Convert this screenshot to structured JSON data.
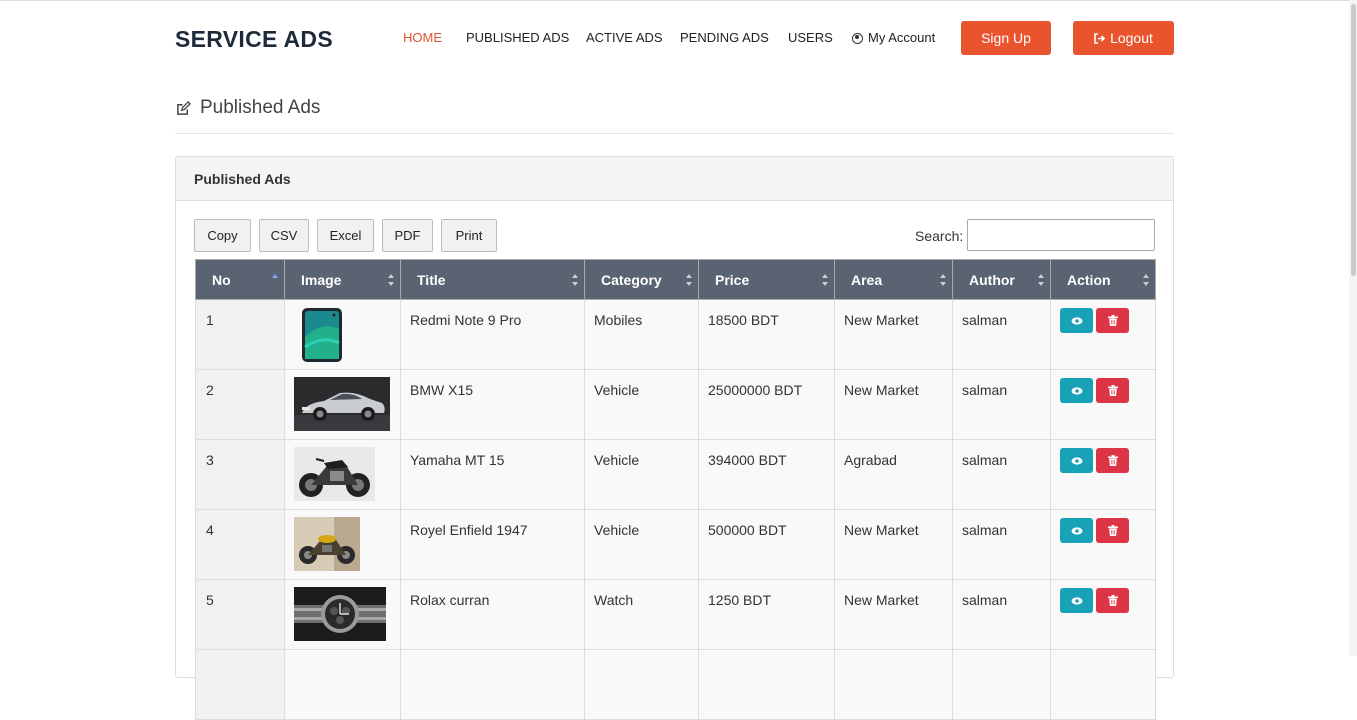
{
  "brand": "SERVICE ADS",
  "nav": {
    "home": "HOME",
    "published": "PUBLISHED ADS",
    "active": "ACTIVE ADS",
    "pending": "PENDING ADS",
    "users": "USERS",
    "account": "My Account"
  },
  "buttons": {
    "signup": "Sign Up",
    "logout": "Logout"
  },
  "page_title": "Published Ads",
  "panel_title": "Published Ads",
  "export_buttons": {
    "copy": "Copy",
    "csv": "CSV",
    "excel": "Excel",
    "pdf": "PDF",
    "print": "Print"
  },
  "search": {
    "label": "Search:",
    "value": ""
  },
  "columns": [
    "No",
    "Image",
    "Title",
    "Category",
    "Price",
    "Area",
    "Author",
    "Action"
  ],
  "rows": [
    {
      "no": "1",
      "image": "phone",
      "title": "Redmi Note 9 Pro",
      "category": "Mobiles",
      "price": "18500 BDT",
      "area": "New Market",
      "author": "salman"
    },
    {
      "no": "2",
      "image": "car",
      "title": "BMW X15",
      "category": "Vehicle",
      "price": "25000000 BDT",
      "area": "New Market",
      "author": "salman"
    },
    {
      "no": "3",
      "image": "motorbike",
      "title": "Yamaha MT 15",
      "category": "Vehicle",
      "price": "394000 BDT",
      "area": "Agrabad",
      "author": "salman"
    },
    {
      "no": "4",
      "image": "motorbike",
      "title": "Royel Enfield 1947",
      "category": "Vehicle",
      "price": "500000 BDT",
      "area": "New Market",
      "author": "salman"
    },
    {
      "no": "5",
      "image": "watch",
      "title": "Rolax curran",
      "category": "Watch",
      "price": "1250 BDT",
      "area": "New Market",
      "author": "salman"
    }
  ],
  "colors": {
    "accent": "#e9542f",
    "header_bg": "#5a6372",
    "view": "#17a2b8",
    "delete": "#dc3545"
  }
}
